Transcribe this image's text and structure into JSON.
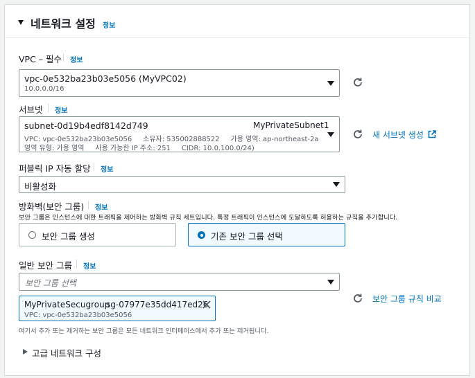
{
  "section": {
    "title": "네트워크 설정",
    "info": "정보"
  },
  "vpc": {
    "label": "VPC – 필수",
    "info": "정보",
    "selected": "vpc-0e532ba23b03e5056 (MyVPC02)",
    "cidr": "10.0.0.0/16"
  },
  "subnet": {
    "label": "서브넷",
    "info": "정보",
    "id": "subnet-0d19b4edf8142d749",
    "name": "MyPrivateSubnet1",
    "line2": "VPC: vpc-0e532ba23b03e5056     소유자: 535002888522     가용 영역: ap-northeast-2a",
    "line3": "영역 유형: 가용 영역     사용 가능한 IP 주소: 251     CIDR: 10.0.100.0/24)",
    "create_link": "새 서브넷 생성"
  },
  "public_ip": {
    "label": "퍼블릭 IP 자동 할당",
    "info": "정보",
    "selected": "비활성화"
  },
  "firewall": {
    "label": "방화벽(보안 그룹)",
    "info": "정보",
    "description": "보안 그룹은 인스턴스에 대한 트래픽을 제어하는 방화벽 규칙 세트입니다. 특정 트래픽이 인스턴스에 도달하도록 허용하는 규칙을 추가합니다.",
    "option_create": "보안 그룹 생성",
    "option_existing": "기존 보안 그룹 선택",
    "selected_option": "기존 보안 그룹 선택"
  },
  "common_sg": {
    "label": "일반 보안 그룹",
    "info": "정보",
    "placeholder": "보안 그룹 선택",
    "compare_link": "보안 그룹 규칙 비교",
    "token_name": "MyPrivateSecugroup",
    "token_id": "sg-07977e35dd417ed26",
    "token_vpc": "VPC: vpc-0e532ba23b03e5056",
    "note": "여기서 추가 또는 제거하는 보안 그룹은 모든 네트워크 인터페이스에서 추가 또는 제거됩니다."
  },
  "advanced": {
    "label": "고급 네트워크 구성"
  },
  "colors": {
    "accent": "#0073bb",
    "border": "#879596",
    "selected_bg": "#f1faff"
  },
  "icons": [
    "caret-down-icon",
    "refresh-icon",
    "external-link-icon",
    "close-icon",
    "caret-right-icon"
  ]
}
